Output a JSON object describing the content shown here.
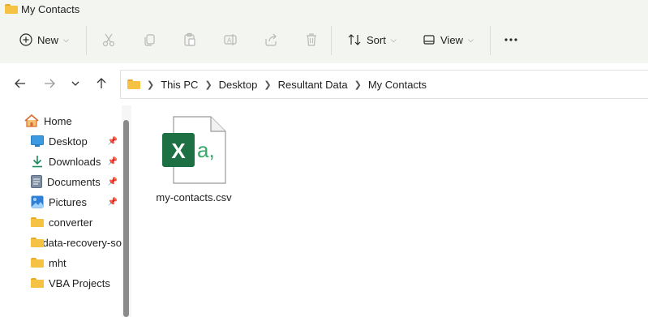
{
  "window": {
    "title": "My Contacts"
  },
  "toolbar": {
    "new_label": "New",
    "sort_label": "Sort",
    "view_label": "View",
    "icons": [
      "cut-icon",
      "copy-icon",
      "paste-icon",
      "rename-icon",
      "share-icon",
      "delete-icon",
      "more-icon"
    ]
  },
  "breadcrumb": [
    "This PC",
    "Desktop",
    "Resultant Data",
    "My Contacts"
  ],
  "sidebar": {
    "home": "Home",
    "items": [
      {
        "label": "Desktop",
        "icon": "desktop-icon",
        "pinned": true
      },
      {
        "label": "Downloads",
        "icon": "downloads-icon",
        "pinned": true
      },
      {
        "label": "Documents",
        "icon": "documents-icon",
        "pinned": true
      },
      {
        "label": "Pictures",
        "icon": "pictures-icon",
        "pinned": true
      },
      {
        "label": "converter",
        "icon": "folder-icon",
        "pinned": false
      },
      {
        "label": "data-recovery-so",
        "icon": "folder-icon",
        "pinned": false
      },
      {
        "label": "mht",
        "icon": "folder-icon",
        "pinned": false
      },
      {
        "label": "VBA Projects",
        "icon": "folder-icon",
        "pinned": false
      }
    ]
  },
  "files": [
    {
      "name": "my-contacts.csv",
      "icon": "excel-csv-icon",
      "icon_letter": "X",
      "icon_suffix": "a,",
      "brand_color": "#1d7044"
    }
  ]
}
